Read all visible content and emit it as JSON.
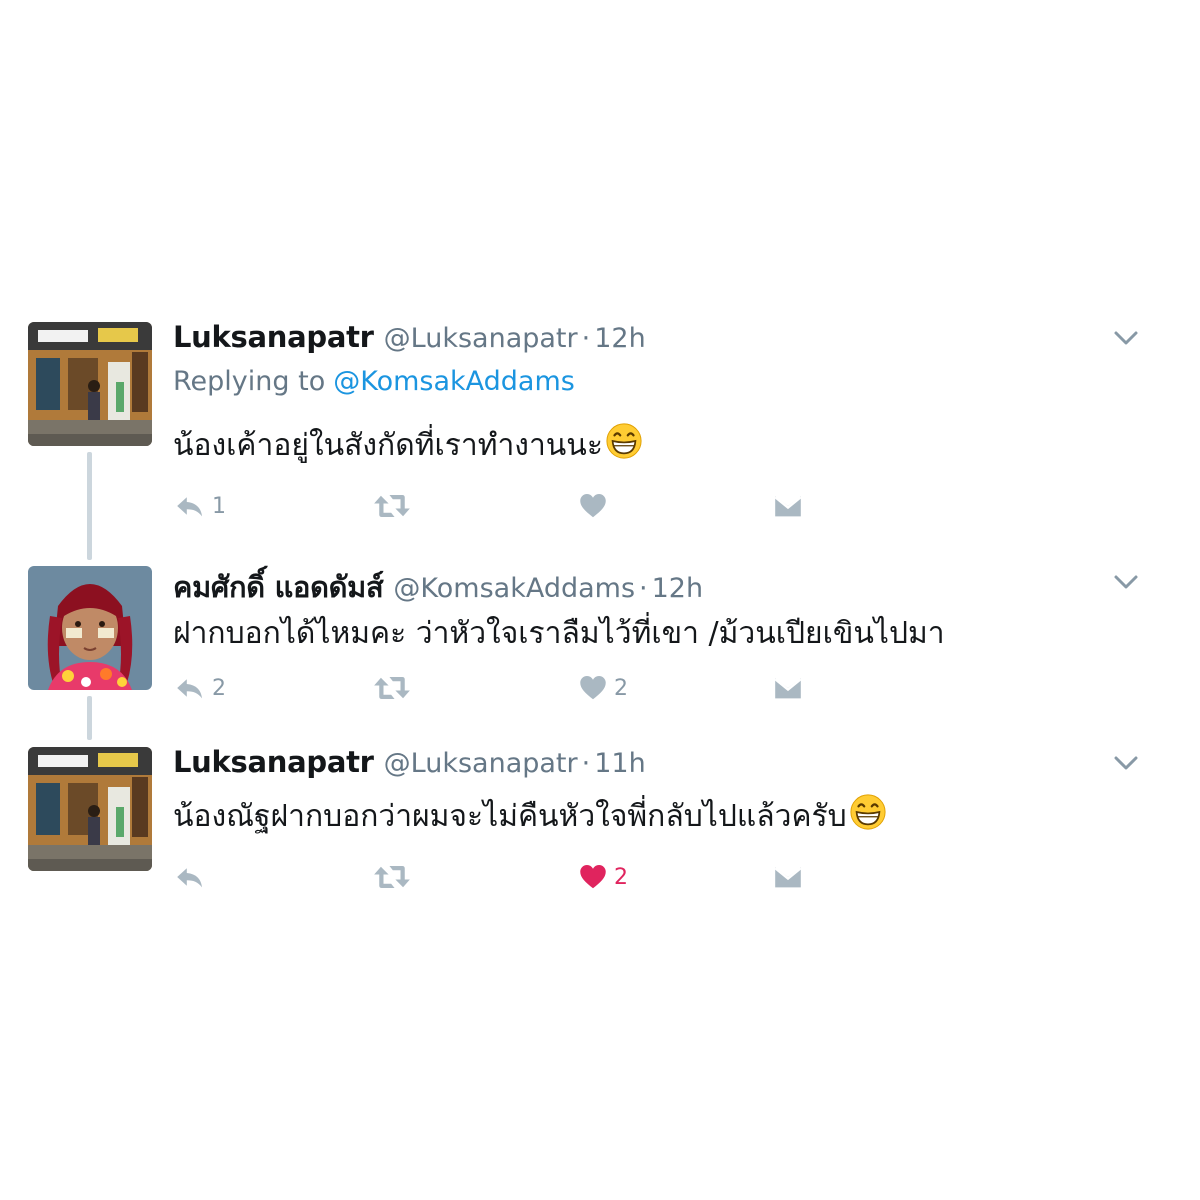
{
  "tweets": [
    {
      "display_name": "Luksanapatr",
      "handle": "@Luksanapatr",
      "separator": "·",
      "time": "12h",
      "replying_prefix": "Replying to",
      "replying_to": "@KomsakAddams",
      "text": "น้องเค้าอยู่ในสังกัดที่เราทำงานนะ",
      "emoji": "grinning-face",
      "reply_count": "1",
      "retweet_count": "",
      "like_count": "",
      "liked": false
    },
    {
      "display_name": "คมศักดิ์ แอดดัมส์",
      "handle": "@KomsakAddams",
      "separator": "·",
      "time": "12h",
      "text": "ฝากบอกได้ไหมคะ ว่าหัวใจเราลืมไว้ที่เขา /ม้วนเปียเขินไปมา",
      "reply_count": "2",
      "retweet_count": "",
      "like_count": "2",
      "liked": false
    },
    {
      "display_name": "Luksanapatr",
      "handle": "@Luksanapatr",
      "separator": "·",
      "time": "11h",
      "text": "น้องณัฐฝากบอกว่าผมจะไม่คืนหัวใจพี่กลับไปแล้วครับ",
      "emoji": "grinning-face",
      "reply_count": "",
      "retweet_count": "",
      "like_count": "2",
      "liked": true
    }
  ],
  "colors": {
    "text": "#14171a",
    "secondary": "#657786",
    "link": "#1b95e0",
    "action_icon": "#aab8c2",
    "like_active": "#e0245e",
    "thread_line": "#ccd6dd"
  },
  "icons": [
    "reply-icon",
    "retweet-icon",
    "heart-icon",
    "direct-message-icon",
    "chevron-down-icon"
  ]
}
